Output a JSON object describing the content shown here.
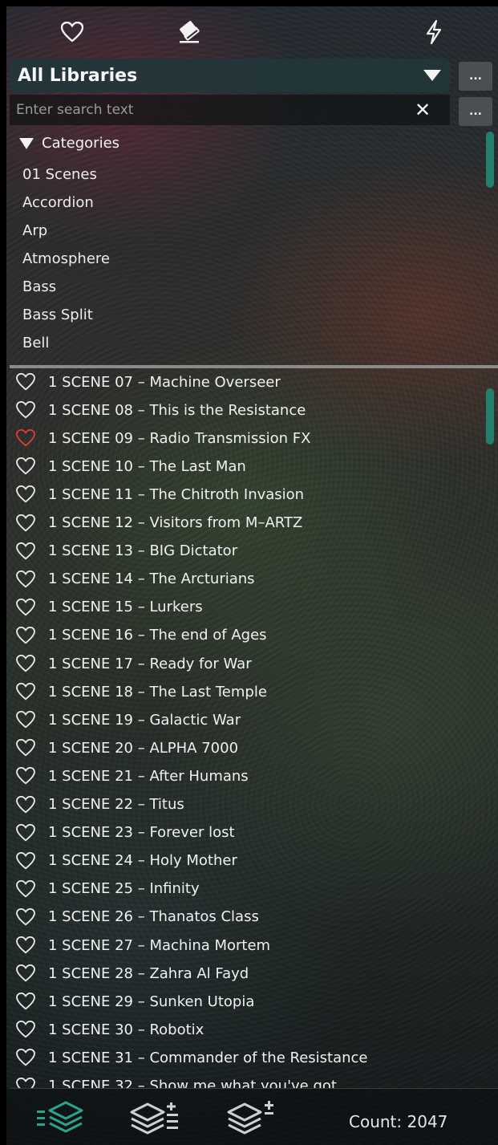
{
  "library": {
    "selected": "All Libraries",
    "more_label": "..."
  },
  "search": {
    "placeholder": "Enter search text",
    "value": "",
    "more_label": "..."
  },
  "categories": {
    "header": "Categories",
    "items": [
      "01 Scenes",
      "Accordion",
      "Arp",
      "Atmosphere",
      "Bass",
      "Bass Split",
      "Bell"
    ]
  },
  "presets": [
    {
      "label": "1 SCENE 07 – Machine Overseer",
      "favorite": false
    },
    {
      "label": "1 SCENE 08 – This is the Resistance",
      "favorite": false
    },
    {
      "label": "1 SCENE 09 – Radio Transmission FX",
      "favorite": true
    },
    {
      "label": "1 SCENE 10 – The Last Man",
      "favorite": false
    },
    {
      "label": "1 SCENE 11 – The Chitroth Invasion",
      "favorite": false
    },
    {
      "label": "1 SCENE 12 – Visitors from M–ARTZ",
      "favorite": false
    },
    {
      "label": "1 SCENE 13 – BIG Dictator",
      "favorite": false
    },
    {
      "label": "1 SCENE 14 – The Arcturians",
      "favorite": false
    },
    {
      "label": "1 SCENE 15 – Lurkers",
      "favorite": false
    },
    {
      "label": "1 SCENE 16 – The end of Ages",
      "favorite": false
    },
    {
      "label": "1 SCENE 17 – Ready for War",
      "favorite": false
    },
    {
      "label": "1 SCENE 18 – The Last Temple",
      "favorite": false
    },
    {
      "label": "1 SCENE 19 – Galactic War",
      "favorite": false
    },
    {
      "label": "1 SCENE 20 – ALPHA 7000",
      "favorite": false
    },
    {
      "label": "1 SCENE 21 – After Humans",
      "favorite": false
    },
    {
      "label": "1 SCENE 22 – Titus",
      "favorite": false
    },
    {
      "label": "1 SCENE 23 – Forever lost",
      "favorite": false
    },
    {
      "label": "1 SCENE 24 – Holy Mother",
      "favorite": false
    },
    {
      "label": "1 SCENE 25 – Infinity",
      "favorite": false
    },
    {
      "label": "1 SCENE 26 – Thanatos Class",
      "favorite": false
    },
    {
      "label": "1 SCENE 27 – Machina Mortem",
      "favorite": false
    },
    {
      "label": "1 SCENE 28 – Zahra Al Fayd",
      "favorite": false
    },
    {
      "label": "1 SCENE 29 – Sunken Utopia",
      "favorite": false
    },
    {
      "label": "1 SCENE 30 – Robotix",
      "favorite": false
    },
    {
      "label": "1 SCENE 31 – Commander of the Resistance",
      "favorite": false
    },
    {
      "label": "1 SCENE 32 – Show me what you've got",
      "favorite": false
    }
  ],
  "footer": {
    "count_label": "Count: 2047"
  },
  "colors": {
    "accent": "#24806c",
    "favorite": "#e03a34",
    "heart_outline": "#e8e8e8"
  },
  "icons": {
    "top": [
      "heart-icon",
      "eraser-icon",
      "lightning-icon"
    ],
    "footer": [
      "layers-list-icon",
      "layers-add-list-icon",
      "layers-add-icon"
    ]
  }
}
